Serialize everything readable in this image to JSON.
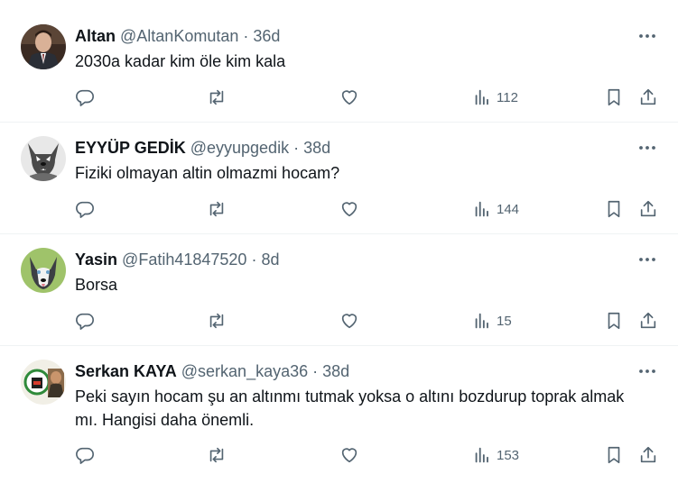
{
  "tweets": [
    {
      "name": "Altan",
      "handle": "@AltanKomutan",
      "separator": "·",
      "time": "36d",
      "text": "2030a kadar kim öle kim kala",
      "views": "112",
      "avatar": "man-in-suit"
    },
    {
      "name": "EYYÜP GEDİK",
      "handle": "@eyyupgedik",
      "separator": "·",
      "time": "38d",
      "text": "Fiziki olmayan altin olmazmi hocam?",
      "views": "144",
      "avatar": "wolf"
    },
    {
      "name": "Yasin",
      "handle": "@Fatih41847520",
      "separator": "·",
      "time": "8d",
      "text": "Borsa",
      "views": "15",
      "avatar": "husky"
    },
    {
      "name": "Serkan KAYA",
      "handle": "@serkan_kaya36",
      "separator": "·",
      "time": "38d",
      "text": "Peki sayın hocam şu an altınmı tutmak  yoksa o altını bozdurup toprak almak mı. Hangisi daha önemli.",
      "views": "153",
      "avatar": "emblem-and-portrait"
    }
  ],
  "icons": {
    "reply": "reply-icon",
    "retweet": "retweet-icon",
    "like": "like-icon",
    "views": "views-icon",
    "bookmark": "bookmark-icon",
    "share": "share-icon",
    "more": "more-icon"
  },
  "colors": {
    "text": "#0f1419",
    "secondary": "#536471",
    "divider": "#eff3f4"
  }
}
